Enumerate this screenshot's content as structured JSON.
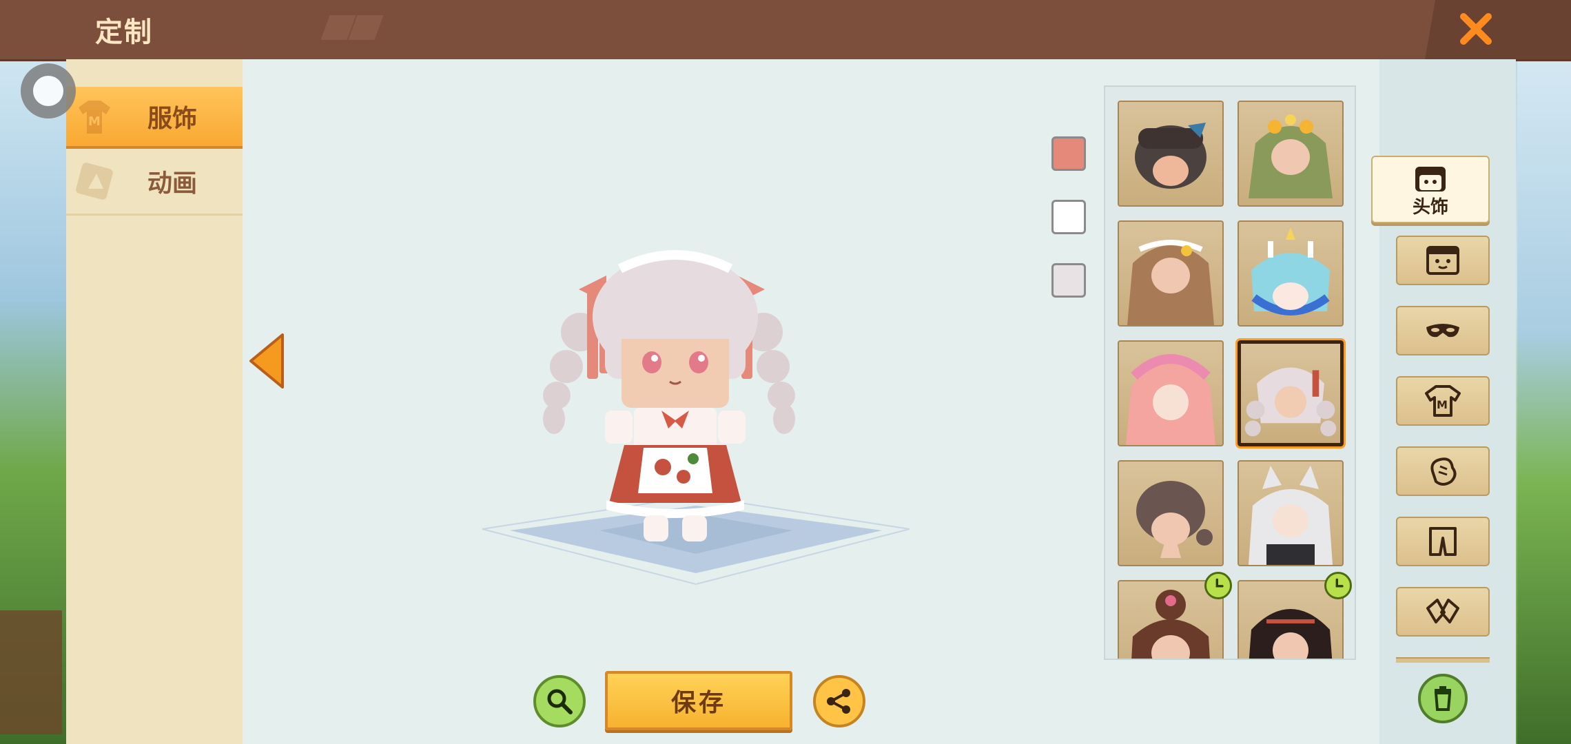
{
  "header": {
    "title": "定制",
    "close_icon": "close-icon"
  },
  "tabs": [
    {
      "label": "服饰",
      "icon": "shirt-icon",
      "active": true
    },
    {
      "label": "动画",
      "icon": "animation-icon",
      "active": false
    }
  ],
  "colors": {
    "accent": "#f9a833",
    "topbar": "#7b4f3c",
    "close": "#ff8a1e",
    "swatches": [
      "#e5897a",
      "#ffffff",
      "#e8e2e4"
    ]
  },
  "swatches": [
    {
      "name": "salmon",
      "color": "#e5897a"
    },
    {
      "name": "white",
      "color": "#ffffff"
    },
    {
      "name": "light-gray",
      "color": "#e8e2e4"
    }
  ],
  "items": [
    {
      "name": "dark-bob-hat",
      "selected": false,
      "timed": false
    },
    {
      "name": "green-flower-hair",
      "selected": false,
      "timed": false
    },
    {
      "name": "brown-wavy-flower",
      "selected": false,
      "timed": false
    },
    {
      "name": "blue-crystal-hair",
      "selected": false,
      "timed": false
    },
    {
      "name": "pink-bonnet-hair",
      "selected": false,
      "timed": false
    },
    {
      "name": "white-braid-ribbon",
      "selected": true,
      "timed": false
    },
    {
      "name": "brown-short-hair",
      "selected": false,
      "timed": false
    },
    {
      "name": "white-cat-ears",
      "selected": false,
      "timed": false
    },
    {
      "name": "red-bun-hair",
      "selected": false,
      "timed": true
    },
    {
      "name": "black-long-hair",
      "selected": false,
      "timed": true
    }
  ],
  "categories": [
    {
      "name": "headwear",
      "icon": "head-icon",
      "label": "头饰",
      "active": true
    },
    {
      "name": "face",
      "icon": "face-icon",
      "active": false
    },
    {
      "name": "mask",
      "icon": "mask-icon",
      "active": false
    },
    {
      "name": "top",
      "icon": "shirt-m-icon",
      "active": false
    },
    {
      "name": "gloves",
      "icon": "glove-icon",
      "active": false
    },
    {
      "name": "pants",
      "icon": "pants-icon",
      "active": false
    },
    {
      "name": "shoes",
      "icon": "shoes-icon",
      "active": false
    }
  ],
  "buttons": {
    "save_label": "保存",
    "zoom_icon": "magnifier-icon",
    "share_icon": "share-icon",
    "delete_icon": "trash-icon"
  }
}
